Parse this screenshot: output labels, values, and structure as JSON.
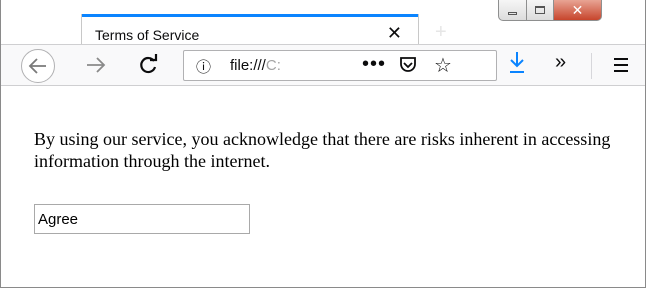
{
  "window": {
    "tab": {
      "title": "Terms of Service",
      "close_glyph": "✕"
    },
    "new_tab_glyph": "+",
    "controls": {
      "close_glyph": "✕"
    }
  },
  "navbar": {
    "url_prefix": "file:///",
    "url_suffix": "C:",
    "url_more": "•••",
    "star_glyph": "☆",
    "overflow_glyph": "»",
    "info_glyph": "ⓘ",
    "icons": [
      "back-arrow-icon",
      "forward-arrow-icon",
      "reload-icon",
      "info-icon",
      "page-actions-icon",
      "pocket-icon",
      "bookmark-star-icon",
      "download-icon",
      "overflow-icon",
      "hamburger-menu-icon"
    ]
  },
  "page": {
    "message": "By using our service, you acknowledge that there are risks inherent in accessing information through the internet.",
    "agree_field": {
      "value": "Agree"
    }
  },
  "colors": {
    "accent": "#0a84ff",
    "close_button": "#c7452c"
  }
}
